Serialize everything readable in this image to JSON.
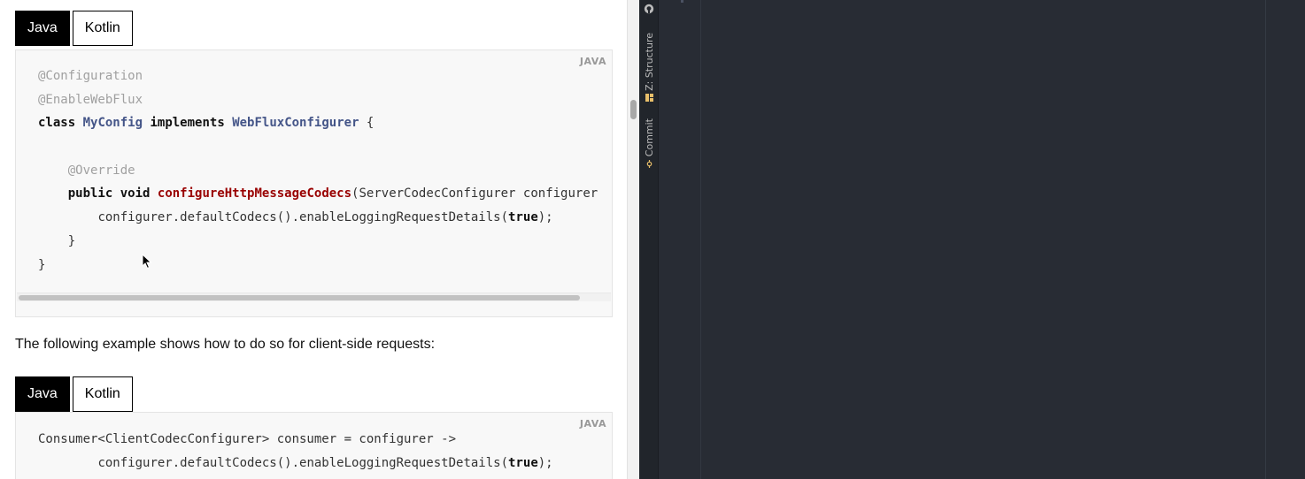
{
  "doc": {
    "tabs_server": [
      {
        "label": "Java",
        "active": true
      },
      {
        "label": "Kotlin",
        "active": false
      }
    ],
    "server_code": {
      "lang_label": "JAVA",
      "lines": [
        {
          "indent": "",
          "tokens": [
            {
              "t": "@Configuration",
              "c": "ann"
            }
          ]
        },
        {
          "indent": "",
          "tokens": [
            {
              "t": "@EnableWebFlux",
              "c": "ann"
            }
          ]
        },
        {
          "indent": "",
          "tokens": [
            {
              "t": "class",
              "c": "kw"
            },
            {
              "t": " ",
              "c": ""
            },
            {
              "t": "MyConfig",
              "c": "type"
            },
            {
              "t": " ",
              "c": ""
            },
            {
              "t": "implements",
              "c": "kw"
            },
            {
              "t": " ",
              "c": ""
            },
            {
              "t": "WebFluxConfigurer",
              "c": "type"
            },
            {
              "t": " {",
              "c": ""
            }
          ]
        },
        {
          "indent": "",
          "tokens": []
        },
        {
          "indent": "    ",
          "tokens": [
            {
              "t": "@Override",
              "c": "ann"
            }
          ]
        },
        {
          "indent": "    ",
          "tokens": [
            {
              "t": "public",
              "c": "kw"
            },
            {
              "t": " ",
              "c": ""
            },
            {
              "t": "void",
              "c": "kw"
            },
            {
              "t": " ",
              "c": ""
            },
            {
              "t": "configureHttpMessageCodecs",
              "c": "fn"
            },
            {
              "t": "(ServerCodecConfigurer configurer",
              "c": ""
            }
          ]
        },
        {
          "indent": "        ",
          "tokens": [
            {
              "t": "configurer.defaultCodecs().enableLoggingRequestDetails(",
              "c": ""
            },
            {
              "t": "true",
              "c": "kw"
            },
            {
              "t": ");",
              "c": ""
            }
          ]
        },
        {
          "indent": "    ",
          "tokens": [
            {
              "t": "}",
              "c": ""
            }
          ]
        },
        {
          "indent": "",
          "tokens": [
            {
              "t": "}",
              "c": ""
            }
          ]
        }
      ]
    },
    "paragraph": "The following example shows how to do so for client-side requests:",
    "tabs_client": [
      {
        "label": "Java",
        "active": true
      },
      {
        "label": "Kotlin",
        "active": false
      }
    ],
    "client_code": {
      "lang_label": "JAVA",
      "lines": [
        {
          "indent": "",
          "tokens": [
            {
              "t": "Consumer<ClientCodecConfigurer> consumer = configurer ->",
              "c": ""
            }
          ]
        },
        {
          "indent": "        ",
          "tokens": [
            {
              "t": "configurer.defaultCodecs().enableLoggingRequestDetails(",
              "c": ""
            },
            {
              "t": "true",
              "c": "kw"
            },
            {
              "t": ");",
              "c": ""
            }
          ]
        }
      ]
    }
  },
  "ide": {
    "tool_windows": {
      "structure_label": "Z: Structure",
      "commit_label": "Commit"
    }
  },
  "colors": {
    "code_bg": "#f8f8f8",
    "ide_bg": "#282c34",
    "annotation": "#a0a0a0",
    "type": "#445588",
    "method": "#990000"
  }
}
